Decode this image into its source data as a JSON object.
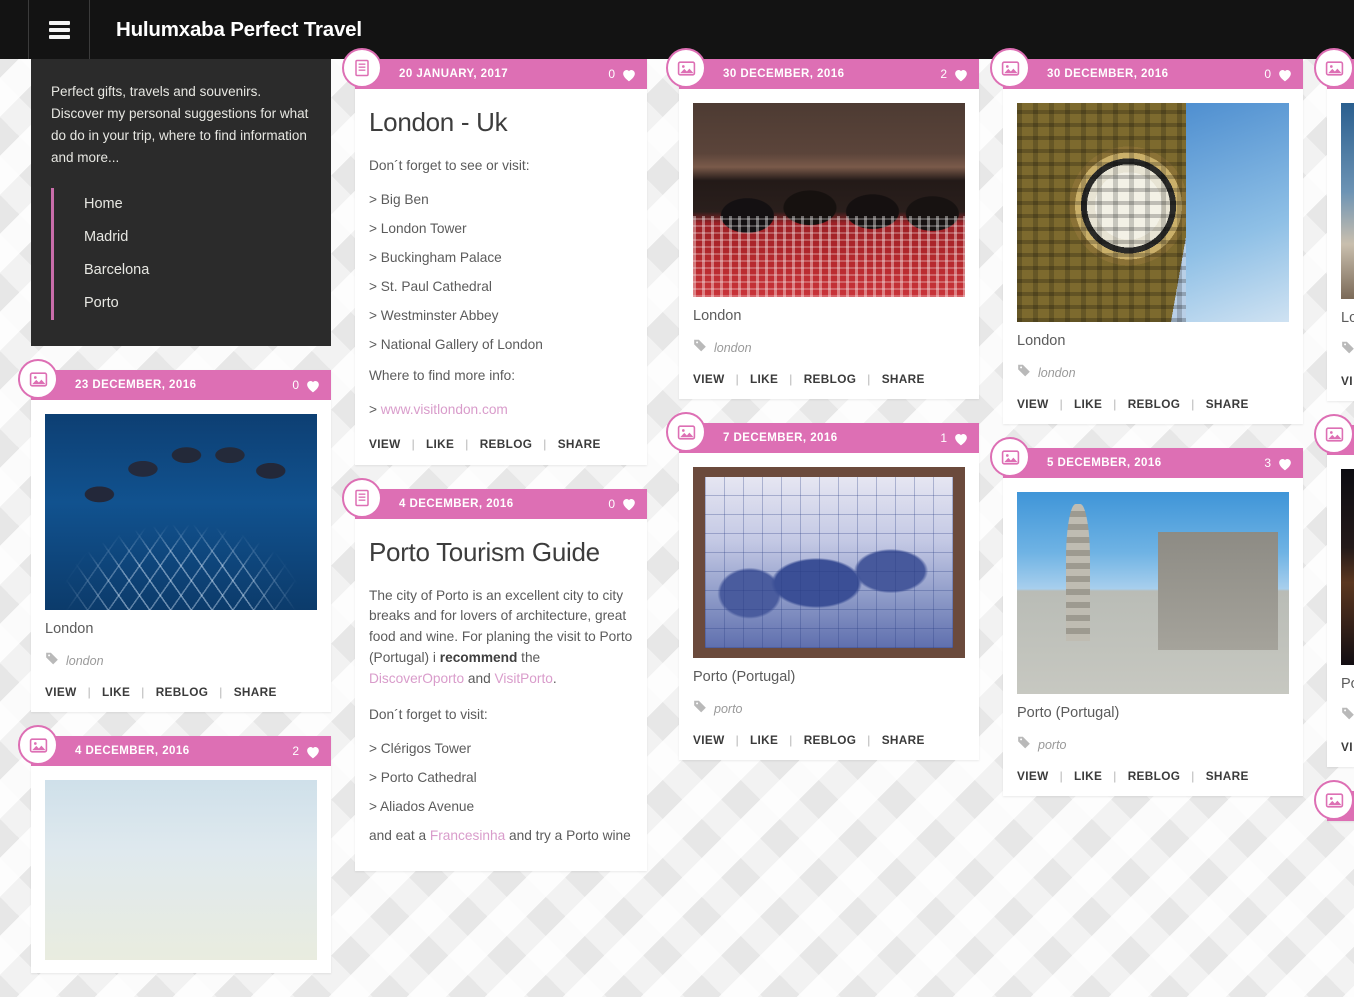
{
  "header": {
    "title": "Hulumxaba Perfect Travel",
    "menu_icon": "hamburger-menu-icon"
  },
  "about": {
    "text": "Perfect gifts, travels and souvenirs. Discover my personal suggestions for what do do in your trip, where to find information and more...",
    "nav": [
      {
        "label": "Home"
      },
      {
        "label": "Madrid"
      },
      {
        "label": "Barcelona"
      },
      {
        "label": "Porto"
      }
    ]
  },
  "actions": {
    "view": "VIEW",
    "like": "LIKE",
    "reblog": "REBLOG",
    "share": "SHARE",
    "separator": "|"
  },
  "colors": {
    "accent_pink": "#dd6fb4",
    "topbar_black": "#131313",
    "about_dark": "#2b2b2b",
    "link_pink": "#d99ccb",
    "nav_rule": "#c96daa"
  },
  "columns": [
    {
      "id": "column-1",
      "cards": [
        {
          "type": "photo",
          "icon": "image-icon",
          "date": "23 DECEMBER, 2016",
          "likes": "0",
          "caption": "London",
          "tag": "london",
          "tag_icon": "tag-icon"
        },
        {
          "type": "photo",
          "icon": "image-icon",
          "date": "4 DECEMBER, 2016",
          "likes": "2",
          "caption": "",
          "tag": "",
          "tag_icon": "tag-icon"
        }
      ]
    },
    {
      "id": "column-2",
      "cards": [
        {
          "type": "text",
          "icon": "document-icon",
          "date": "20 JANUARY, 2017",
          "likes": "0",
          "title": "London  - Uk",
          "intro": "Don´t forget to see or visit:",
          "list": [
            "> Big Ben",
            "> London Tower",
            "> Buckingham Palace",
            "> St. Paul Cathedral",
            "> Westminster Abbey",
            "> National Gallery of London"
          ],
          "info_label": "Where to find more info:",
          "info_prefix": "> ",
          "info_link": "www.visitlondon.com"
        },
        {
          "type": "text",
          "icon": "document-icon",
          "date": "4 DECEMBER, 2016",
          "likes": "0",
          "title": "Porto Tourism Guide",
          "para_1": "The city of Porto is an excellent city to city breaks and for lovers of architecture, great food and wine. For planing the visit to Porto (Portugal) i ",
          "para_bold": "recommend",
          "para_2": " the ",
          "link_1": "DiscoverOporto",
          "para_3": " and ",
          "link_2": "VisitPorto",
          "para_4": ".",
          "intro": "Don´t forget to visit:",
          "list": [
            "> Clérigos Tower",
            "> Porto Cathedral",
            "> Aliados Avenue"
          ],
          "tail_pre": "and eat a ",
          "tail_link": "Francesinha",
          "tail_post": " and try a Porto wine"
        }
      ]
    },
    {
      "id": "column-3",
      "cards": [
        {
          "type": "photo",
          "icon": "image-icon",
          "date": "30 DECEMBER, 2016",
          "likes": "2",
          "caption": "London",
          "tag": "london",
          "tag_icon": "tag-icon"
        },
        {
          "type": "photo",
          "icon": "image-icon",
          "date": "7 DECEMBER, 2016",
          "likes": "1",
          "caption": "Porto (Portugal)",
          "tag": "porto",
          "tag_icon": "tag-icon"
        }
      ]
    },
    {
      "id": "column-4",
      "cards": [
        {
          "type": "photo",
          "icon": "image-icon",
          "date": "30 DECEMBER, 2016",
          "likes": "0",
          "caption": "London",
          "tag": "london",
          "tag_icon": "tag-icon"
        },
        {
          "type": "photo",
          "icon": "image-icon",
          "date": "5 DECEMBER, 2016",
          "likes": "3",
          "caption": "Porto (Portugal)",
          "tag": "porto",
          "tag_icon": "tag-icon"
        }
      ]
    },
    {
      "id": "column-5-clipped",
      "cards": [
        {
          "type": "photo",
          "icon": "image-icon",
          "date": "",
          "likes": "",
          "caption": "Lo",
          "tag": "",
          "tag_icon": "tag-icon",
          "action_clipped": "VI"
        },
        {
          "type": "photo",
          "icon": "image-icon",
          "date": "",
          "likes": "",
          "caption": "Po",
          "tag": "",
          "tag_icon": "tag-icon",
          "action_clipped": "VI"
        }
      ]
    }
  ]
}
